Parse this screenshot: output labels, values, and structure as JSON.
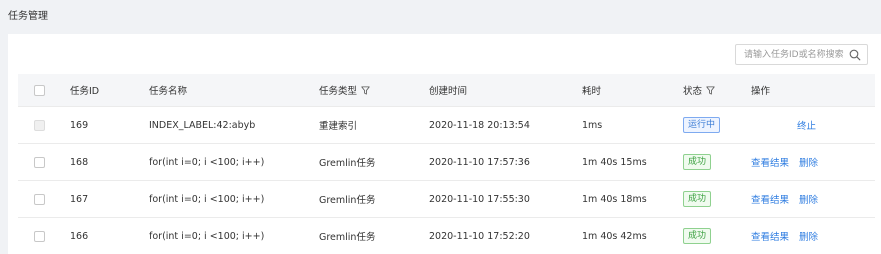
{
  "page": {
    "title": "任务管理"
  },
  "search": {
    "placeholder": "请输入任务ID或名称搜索"
  },
  "columns": {
    "id": "任务ID",
    "name": "任务名称",
    "type": "任务类型",
    "created": "创建时间",
    "duration": "耗时",
    "status": "状态",
    "actions": "操作"
  },
  "rows": [
    {
      "id": "169",
      "name": "INDEX_LABEL:42:abyb",
      "type": "重建索引",
      "created": "2020-11-18 20:13:54",
      "duration": "1ms",
      "status": "运行中",
      "status_kind": "running",
      "action1": "",
      "action2": "终止",
      "selectable": false
    },
    {
      "id": "168",
      "name": "for(int i=0; i <100; i++)",
      "type": "Gremlin任务",
      "created": "2020-11-10 17:57:36",
      "duration": "1m 40s 15ms",
      "status": "成功",
      "status_kind": "success",
      "action1": "查看结果",
      "action2": "删除",
      "selectable": true
    },
    {
      "id": "167",
      "name": "for(int i=0; i <100; i++)",
      "type": "Gremlin任务",
      "created": "2020-11-10 17:55:30",
      "duration": "1m 40s 18ms",
      "status": "成功",
      "status_kind": "success",
      "action1": "查看结果",
      "action2": "删除",
      "selectable": true
    },
    {
      "id": "166",
      "name": "for(int i=0; i <100; i++)",
      "type": "Gremlin任务",
      "created": "2020-11-10 17:52:20",
      "duration": "1m 40s 42ms",
      "status": "成功",
      "status_kind": "success",
      "action1": "查看结果",
      "action2": "删除",
      "selectable": true
    }
  ],
  "colors": {
    "background": "#f0f2f5",
    "running": "#3a7bd5",
    "success": "#3aa03f",
    "link": "#2f7de1"
  }
}
